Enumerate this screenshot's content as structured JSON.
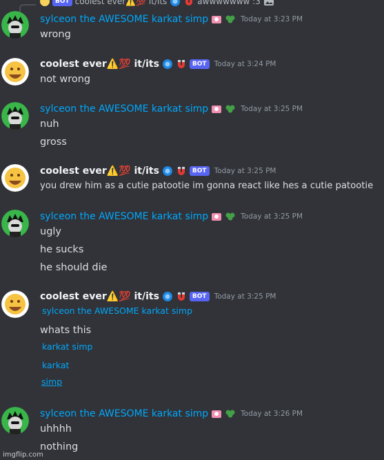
{
  "reply": {
    "bot_tag": "BOT",
    "author": "coolest ever⚠️💯 it/its",
    "snippet": "awwwwwww :3"
  },
  "messages": [
    {
      "author": "sylceon the AWESOME karkat simp",
      "timestamp": "Today at 3:23 PM",
      "lines": [
        "wrong"
      ]
    },
    {
      "author": "coolest ever⚠️💯 it/its",
      "bot_tag": "BOT",
      "timestamp": "Today at 3:24 PM",
      "lines": [
        "not wrong"
      ]
    },
    {
      "author": "sylceon the AWESOME karkat simp",
      "timestamp": "Today at 3:25 PM",
      "lines": [
        "nuh",
        "gross"
      ]
    },
    {
      "author": "coolest ever⚠️💯 it/its",
      "bot_tag": "BOT",
      "timestamp": "Today at 3:25 PM",
      "lines": [
        "you drew him as a cutie patootie im gonna react like hes a cutie patootie"
      ]
    },
    {
      "author": "sylceon the AWESOME karkat simp",
      "timestamp": "Today at 3:25 PM",
      "lines": [
        "ugly",
        "he sucks",
        "he should die"
      ]
    },
    {
      "author": "coolest ever⚠️💯 it/its",
      "bot_tag": "BOT",
      "timestamp": "Today at 3:25 PM",
      "mention": "sylceon the AWESOME karkat simp",
      "lines": [
        "whats this"
      ],
      "links": [
        "karkat simp",
        "karkat",
        "simp"
      ]
    },
    {
      "author": "sylceon the AWESOME karkat simp",
      "timestamp": "Today at 3:26 PM",
      "lines": [
        "uhhhh",
        "nothing"
      ]
    }
  ],
  "watermark": "imgflip.com"
}
